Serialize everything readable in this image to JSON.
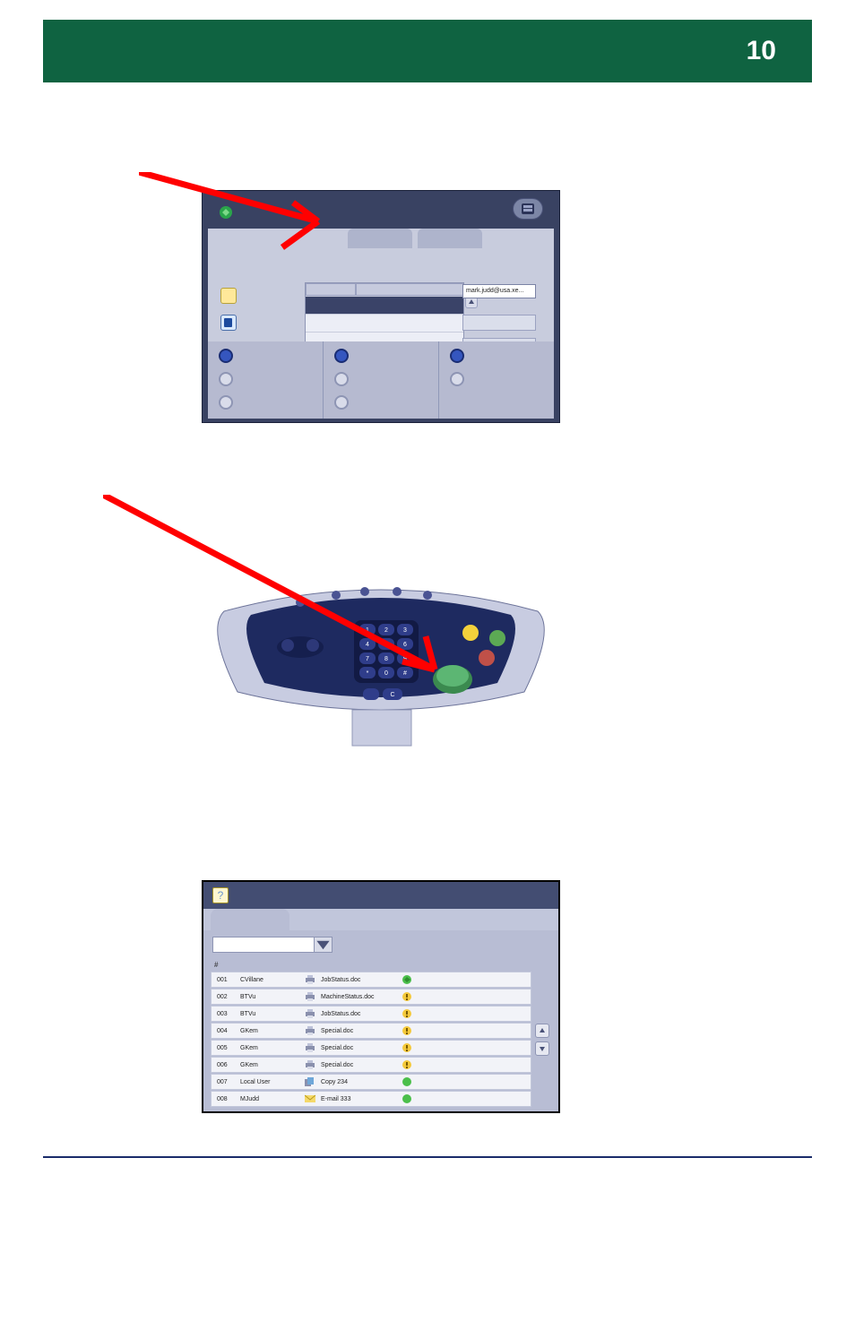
{
  "header": {
    "page_number": "10"
  },
  "figure1": {
    "from_field": "mark.judd@usa.xe...",
    "top_tabs": [
      "",
      "",
      ""
    ],
    "table_headers": [
      "",
      ""
    ],
    "side_buttons": [
      "",
      ""
    ]
  },
  "figure2": {
    "keypad": {
      "row1": [
        "1",
        "2",
        "3"
      ],
      "row2": [
        "4",
        "5",
        "6"
      ],
      "row3": [
        "7",
        "8",
        "9"
      ],
      "row4": [
        "*",
        "0",
        "#"
      ],
      "extra": [
        "",
        "C"
      ]
    }
  },
  "figure3": {
    "hash_label": "#",
    "rows": [
      {
        "id": "001",
        "owner": "CVillane",
        "job": "JobStatus.doc",
        "icon": "printer",
        "status": "go"
      },
      {
        "id": "002",
        "owner": "BTVu",
        "job": "MachineStatus.doc",
        "icon": "printer",
        "status": "warn"
      },
      {
        "id": "003",
        "owner": "BTVu",
        "job": "JobStatus.doc",
        "icon": "printer",
        "status": "warn"
      },
      {
        "id": "004",
        "owner": "GKem",
        "job": "Special.doc",
        "icon": "printer",
        "status": "warn"
      },
      {
        "id": "005",
        "owner": "GKem",
        "job": "Special.doc",
        "icon": "printer",
        "status": "warn"
      },
      {
        "id": "006",
        "owner": "GKem",
        "job": "Special.doc",
        "icon": "printer",
        "status": "warn"
      },
      {
        "id": "007",
        "owner": "Local User",
        "job": "Copy 234",
        "icon": "copy",
        "status": "done"
      },
      {
        "id": "008",
        "owner": "MJudd",
        "job": "E-mail 333",
        "icon": "mail",
        "status": "done"
      }
    ]
  }
}
